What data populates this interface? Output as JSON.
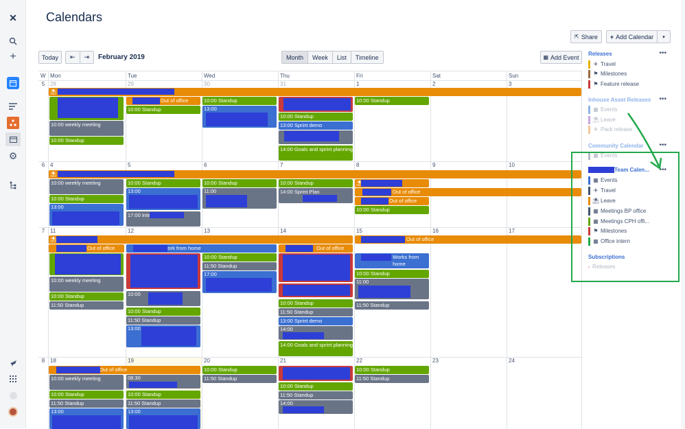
{
  "page": {
    "title": "Calendars"
  },
  "nav": {
    "icons": [
      "confluence-logo-icon",
      "search-icon",
      "plus-icon",
      "space-icon",
      "feed-icon",
      "tree-icon",
      "calendar-icon",
      "gear-icon",
      "hierarchy-icon",
      "rocket-icon",
      "apps-grid-icon",
      "help-icon",
      "user-avatar"
    ]
  },
  "toolbar": {
    "share_label": "Share",
    "add_calendar_label": "Add Calendar",
    "today_label": "Today",
    "prev_symbol": "⇤",
    "next_symbol": "⇥",
    "month_label": "February 2019",
    "views": [
      "Month",
      "Week",
      "List",
      "Timeline"
    ],
    "add_event_label": "Add Event"
  },
  "calendar": {
    "week_col": "W",
    "day_headers": [
      "Mon",
      "Tue",
      "Wed",
      "Thu",
      "Fri",
      "Sat",
      "Sun"
    ],
    "weeks": [
      {
        "num": "5",
        "days": [
          "28",
          "29",
          "30",
          "31",
          "1",
          "2",
          "3"
        ]
      },
      {
        "num": "6",
        "days": [
          "4",
          "5",
          "6",
          "7",
          "8",
          "9",
          "10"
        ]
      },
      {
        "num": "7",
        "days": [
          "11",
          "12",
          "13",
          "14",
          "15",
          "16",
          "17"
        ]
      },
      {
        "num": "8",
        "days": [
          "18",
          "19",
          "20",
          "21",
          "22",
          "23",
          "24"
        ]
      }
    ],
    "event_labels": {
      "out_of_office": "Out of office",
      "standup_1000": "10:00 Standup",
      "standup_1150": "11:50 Standup",
      "weekly": "10:00        weekly meeting",
      "t1300": "13:00",
      "t1100": "11:00",
      "t1700": "17:00",
      "t1400": "14:00",
      "t1000": "10:00",
      "t0830": "08:30",
      "sprint_demo": "13:00 Sprint demo",
      "goals": "14:00 Goals and sprint planning",
      "work_from_home": "work from home",
      "works_from": "Works from home",
      "interview": "17:00 Intervie",
      "sprint_plan": "14:00 Sprint Plan"
    }
  },
  "sidebar": {
    "sections": [
      {
        "title": "Releases",
        "items": [
          {
            "label": "Travel",
            "icon": "airplane-icon",
            "color": "#e8b300"
          },
          {
            "label": "Milestones",
            "icon": "flag-icon",
            "color": "#9c6b43"
          },
          {
            "label": "Feature release",
            "icon": "flag-icon",
            "color": "#c93a3a"
          }
        ]
      },
      {
        "title": "Inhouse Asset Releases",
        "items": [
          {
            "label": "Events",
            "icon": "calendar-icon",
            "color": "#8fb3ea"
          },
          {
            "label": "Leave",
            "icon": "leave-icon",
            "color": "#c5a8e0"
          },
          {
            "label": "Pack release",
            "icon": "airplane-icon",
            "color": "#f4c79a"
          }
        ]
      },
      {
        "title": "Community Calendar",
        "items": [
          {
            "label": "Events",
            "icon": "calendar-icon",
            "color": "#b3bac5"
          }
        ]
      },
      {
        "title": "Team Calen...",
        "items": [
          {
            "label": "Events",
            "icon": "calendar-icon",
            "color": "#3b6fd1"
          },
          {
            "label": "Travel",
            "icon": "airplane-icon",
            "color": "#42526e"
          },
          {
            "label": "Leave",
            "icon": "leave-icon",
            "color": "#e88b07"
          },
          {
            "label": "Meetings BP office",
            "icon": "calendar-icon",
            "color": "#42526e"
          },
          {
            "label": "Meetings CPH offi...",
            "icon": "calendar-icon",
            "color": "#63a600"
          },
          {
            "label": "Milestones",
            "icon": "flag-icon",
            "color": "#c93a3a"
          },
          {
            "label": "Office intern",
            "icon": "calendar-icon",
            "color": "#21a84b"
          }
        ]
      },
      {
        "title": "Subscriptions",
        "items": [
          {
            "label": "Releases",
            "icon": "",
            "color": "#e8a0a0"
          }
        ]
      }
    ],
    "more_symbol": "•••"
  }
}
